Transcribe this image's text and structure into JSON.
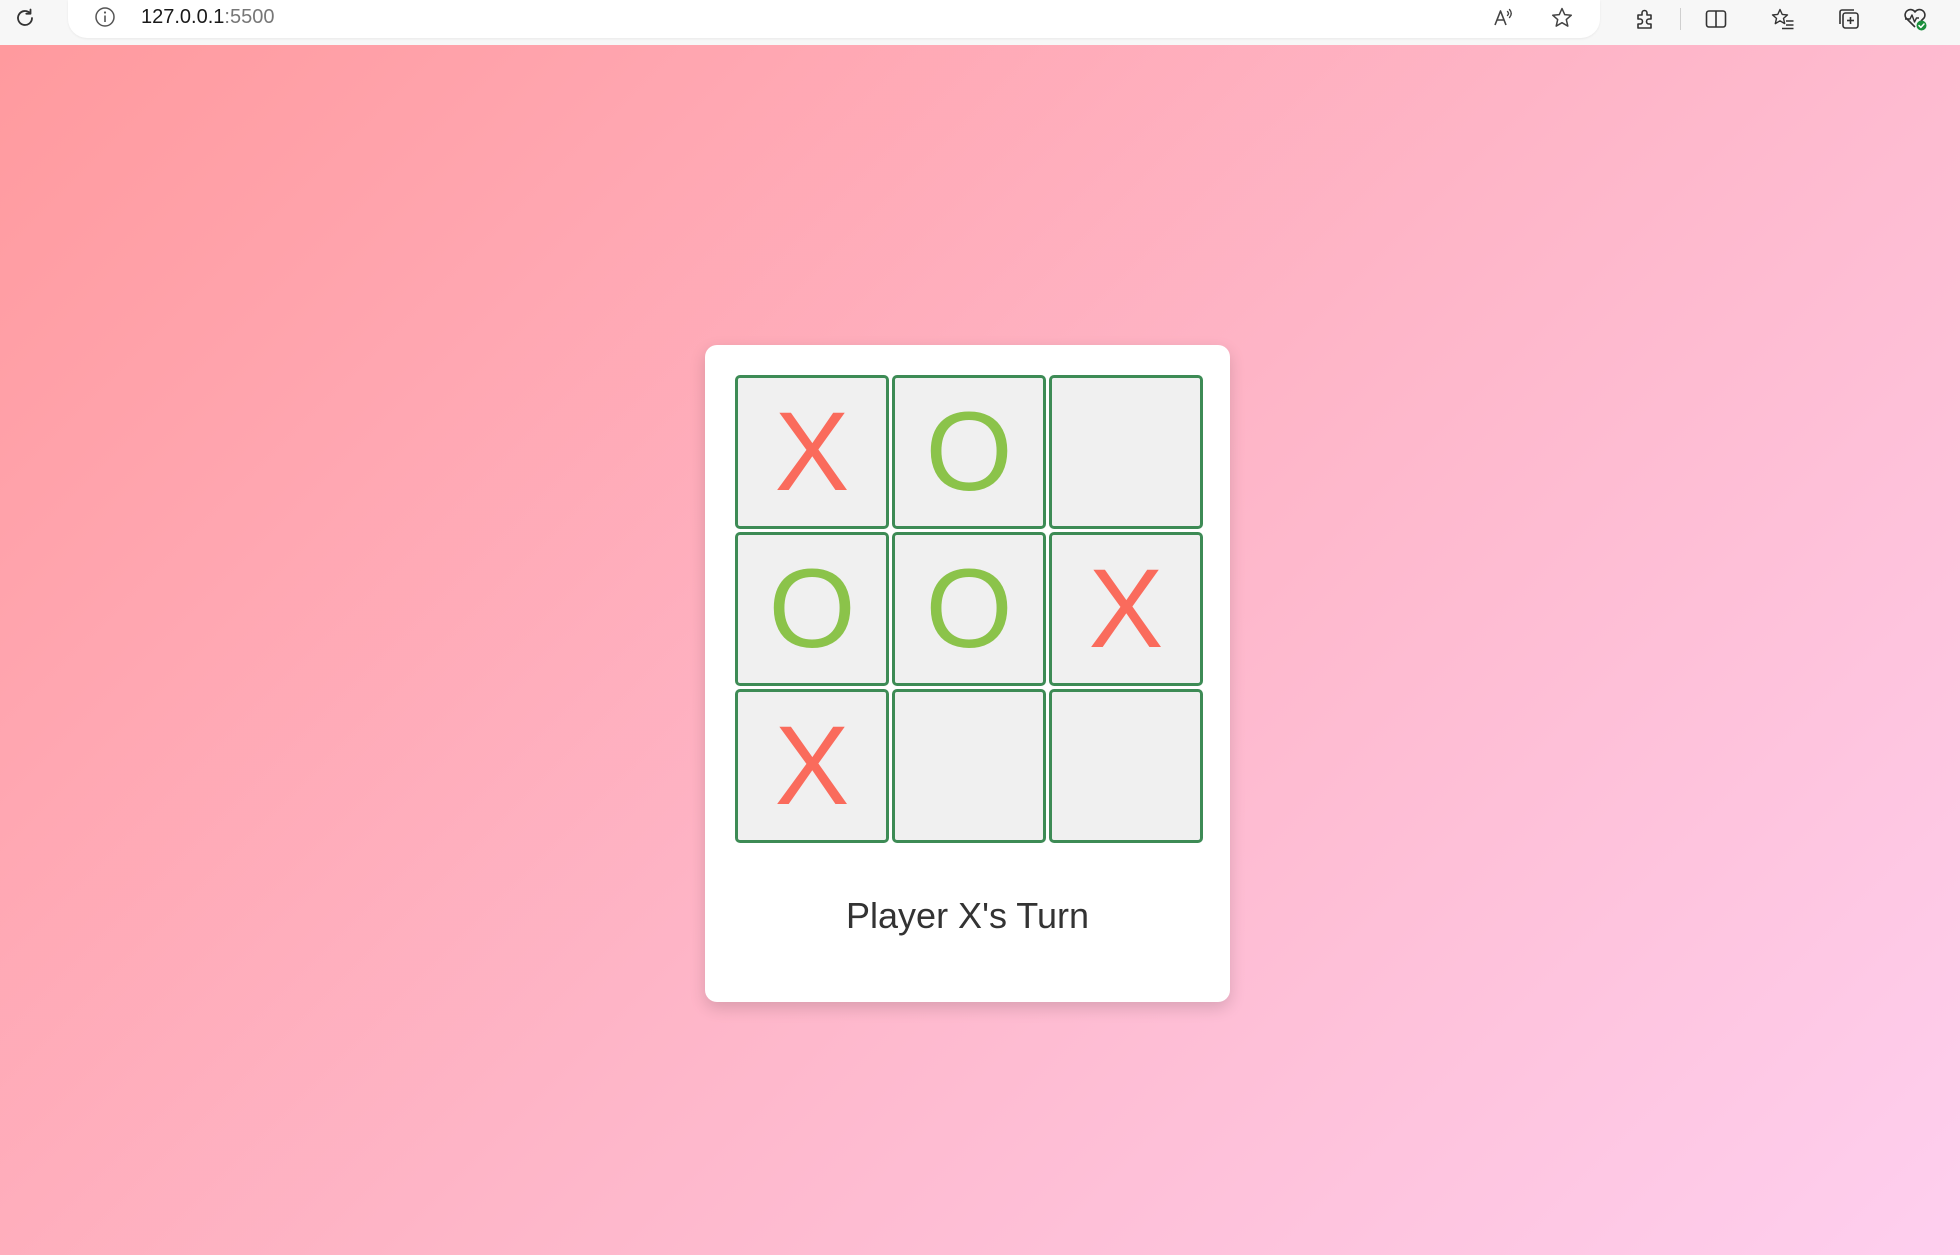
{
  "browser": {
    "url_host": "127.0.0.1",
    "url_port": ":5500",
    "icons": {
      "reload": "reload-icon",
      "site_info": "info-icon",
      "read_aloud": "read-aloud-icon",
      "favorite": "star-icon",
      "extensions": "puzzle-icon",
      "split_screen": "split-screen-icon",
      "favorites": "favorites-list-icon",
      "collections": "collections-icon",
      "browser_essentials": "heart-pulse-icon"
    }
  },
  "colors": {
    "background_gradient_start": "#ff9a9e",
    "background_gradient_end": "#fecfef",
    "card": "#ffffff",
    "cell_fill": "#f0f0f0",
    "cell_border": "#3d8b55",
    "x_mark": "#fa6b5c",
    "o_mark": "#8bc34a",
    "status_text": "#333333"
  },
  "board": {
    "cells": [
      "X",
      "O",
      "",
      "O",
      "O",
      "X",
      "X",
      "",
      ""
    ]
  },
  "status": {
    "text": "Player X's Turn"
  }
}
